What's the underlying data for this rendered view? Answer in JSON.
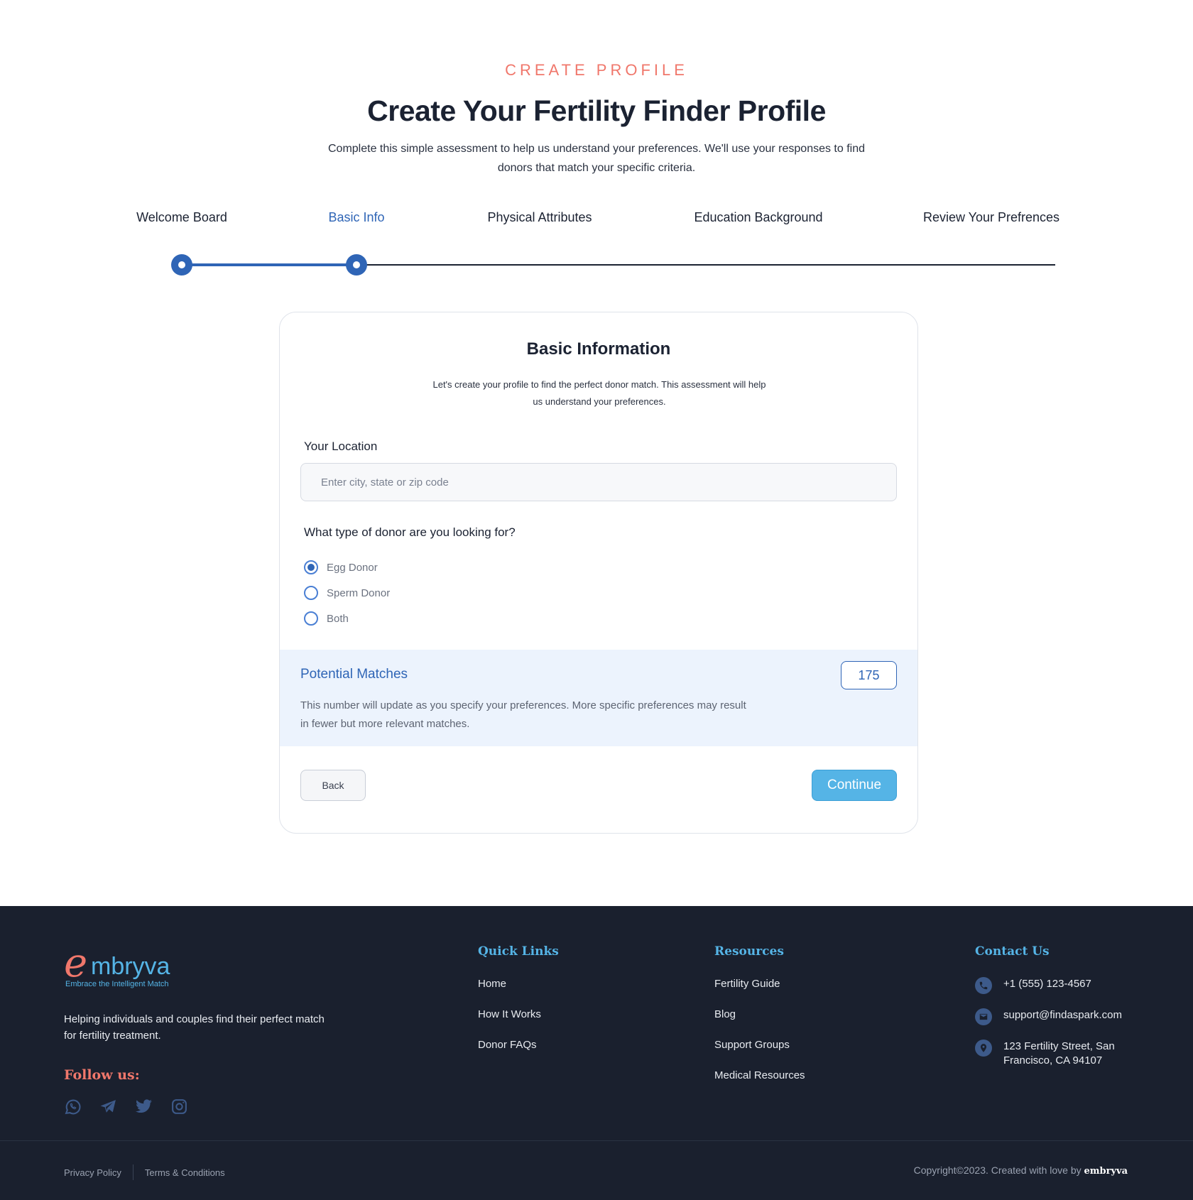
{
  "header": {
    "eyebrow": "CREATE PROFILE",
    "title": "Create Your Fertility Finder Profile",
    "subtitle": "Complete this simple assessment to help us understand your preferences. We'll use your responses to find donors that match your specific criteria."
  },
  "steps": [
    {
      "label": "Welcome Board",
      "state": "done"
    },
    {
      "label": "Basic Info",
      "state": "active"
    },
    {
      "label": "Physical Attributes",
      "state": "pending"
    },
    {
      "label": "Education Background",
      "state": "pending"
    },
    {
      "label": "Review Your Prefrences",
      "state": "pending"
    }
  ],
  "form": {
    "title": "Basic Information",
    "description": "Let's create your profile to find the perfect donor match. This assessment will help us understand your preferences.",
    "location": {
      "label": "Your Location",
      "placeholder": "Enter city, state or zip code",
      "value": ""
    },
    "donor_type": {
      "question": "What type of donor are you looking for?",
      "options": [
        "Egg Donor",
        "Sperm Donor",
        "Both"
      ],
      "selected": "Egg Donor"
    },
    "matches": {
      "title": "Potential Matches",
      "count": "175",
      "description": "This number will update as you specify your preferences. More specific preferences may result in fewer but more relevant matches."
    },
    "back_label": "Back",
    "continue_label": "Continue"
  },
  "footer": {
    "logo": {
      "initial": "e",
      "word": "mbryva",
      "tagline": "Embrace the Intelligent Match"
    },
    "about": "Helping individuals and couples find their perfect match for fertility treatment.",
    "follow_label": "Follow us:",
    "socials": [
      "whatsapp-icon",
      "telegram-icon",
      "twitter-icon",
      "instagram-icon"
    ],
    "quick_links": {
      "title": "Quick Links",
      "items": [
        "Home",
        "How It Works",
        "Donor FAQs"
      ]
    },
    "resources": {
      "title": "Resources",
      "items": [
        "Fertility Guide",
        "Blog",
        "Support Groups",
        "Medical Resources"
      ]
    },
    "contact": {
      "title": "Contact Us",
      "phone": "+1 (555) 123-4567",
      "email": "support@findaspark.com",
      "address": "123 Fertility Street, San Francisco, CA 94107"
    },
    "legal": [
      "Privacy Policy",
      "Terms & Conditions"
    ],
    "copyright_text": "Copyright©2023. Created with love by ",
    "copyright_brand": "embryva"
  },
  "colors": {
    "accent": "#2f65b6",
    "coral": "#f0776b",
    "sky": "#55b4e6",
    "footer_bg": "#1a202e"
  }
}
